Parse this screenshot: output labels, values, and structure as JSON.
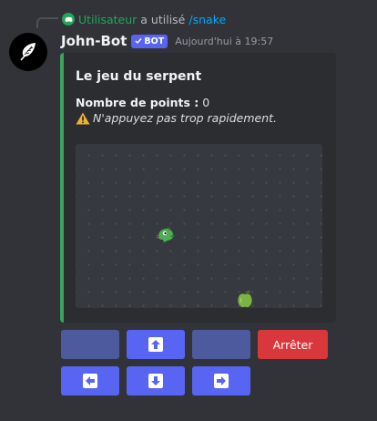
{
  "reply": {
    "user": "Utilisateur",
    "action": "a utilisé",
    "command": "/snake"
  },
  "message": {
    "author": "John-Bot",
    "badge": "BOT",
    "timestamp": "Aujourd'hui à 19:57"
  },
  "embed": {
    "title": "Le jeu du serpent",
    "score_label": "Nombre de points :",
    "score_value": "0",
    "warning": "N'appuyez pas trop rapidement.",
    "accent_color": "#3ba55c"
  },
  "buttons": {
    "row1": [
      {
        "name": "blank-button-left",
        "label": ""
      },
      {
        "name": "up-button",
        "icon": "arrow-up-icon"
      },
      {
        "name": "blank-button-right",
        "label": ""
      },
      {
        "name": "stop-button",
        "label": "Arrêter"
      }
    ],
    "row2": [
      {
        "name": "left-button",
        "icon": "arrow-left-icon"
      },
      {
        "name": "down-button",
        "icon": "arrow-down-icon"
      },
      {
        "name": "right-button",
        "icon": "arrow-right-icon"
      }
    ]
  },
  "colors": {
    "background": "#313338",
    "blurple": "#5865f2",
    "danger": "#da373c"
  }
}
